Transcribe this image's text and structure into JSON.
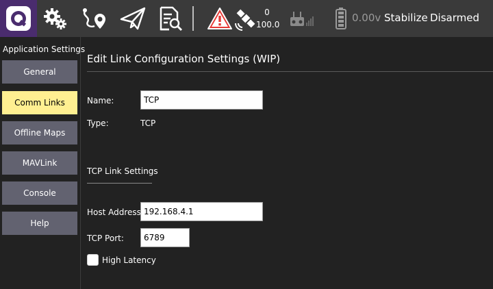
{
  "toolbar": {
    "icons": [
      "qgc-logo-icon",
      "settings-gears-icon",
      "plan-route-icon",
      "fly-paper-plane-icon",
      "analyze-document-icon",
      "warning-icon",
      "gps-satellite-icon",
      "rc-signal-icon",
      "battery-icon"
    ],
    "gps_count": "0",
    "gps_hdop": "100.0",
    "battery_voltage": "0.00v",
    "flight_mode": "Stabilize",
    "arm_state": "Disarmed",
    "colors": {
      "bar": "#3a3a3a",
      "logo_bg": "#4a2c6e",
      "warning": "#e53935"
    }
  },
  "sidebar": {
    "title": "Application Settings",
    "items": [
      {
        "label": "General",
        "active": false
      },
      {
        "label": "Comm Links",
        "active": true
      },
      {
        "label": "Offline Maps",
        "active": false
      },
      {
        "label": "MAVLink",
        "active": false
      },
      {
        "label": "Console",
        "active": false
      },
      {
        "label": "Help",
        "active": false
      }
    ],
    "colors": {
      "button": "#626270",
      "active": "#ffef91"
    }
  },
  "main": {
    "title": "Edit Link Configuration Settings (WIP)",
    "name_label": "Name:",
    "name_value": "TCP",
    "type_label": "Type:",
    "type_value": "TCP",
    "section_title": "TCP Link Settings",
    "host_label": "Host Address:",
    "host_value": "192.168.4.1",
    "port_label": "TCP Port:",
    "port_value": "6789",
    "high_latency_label": "High Latency",
    "high_latency_checked": false
  }
}
